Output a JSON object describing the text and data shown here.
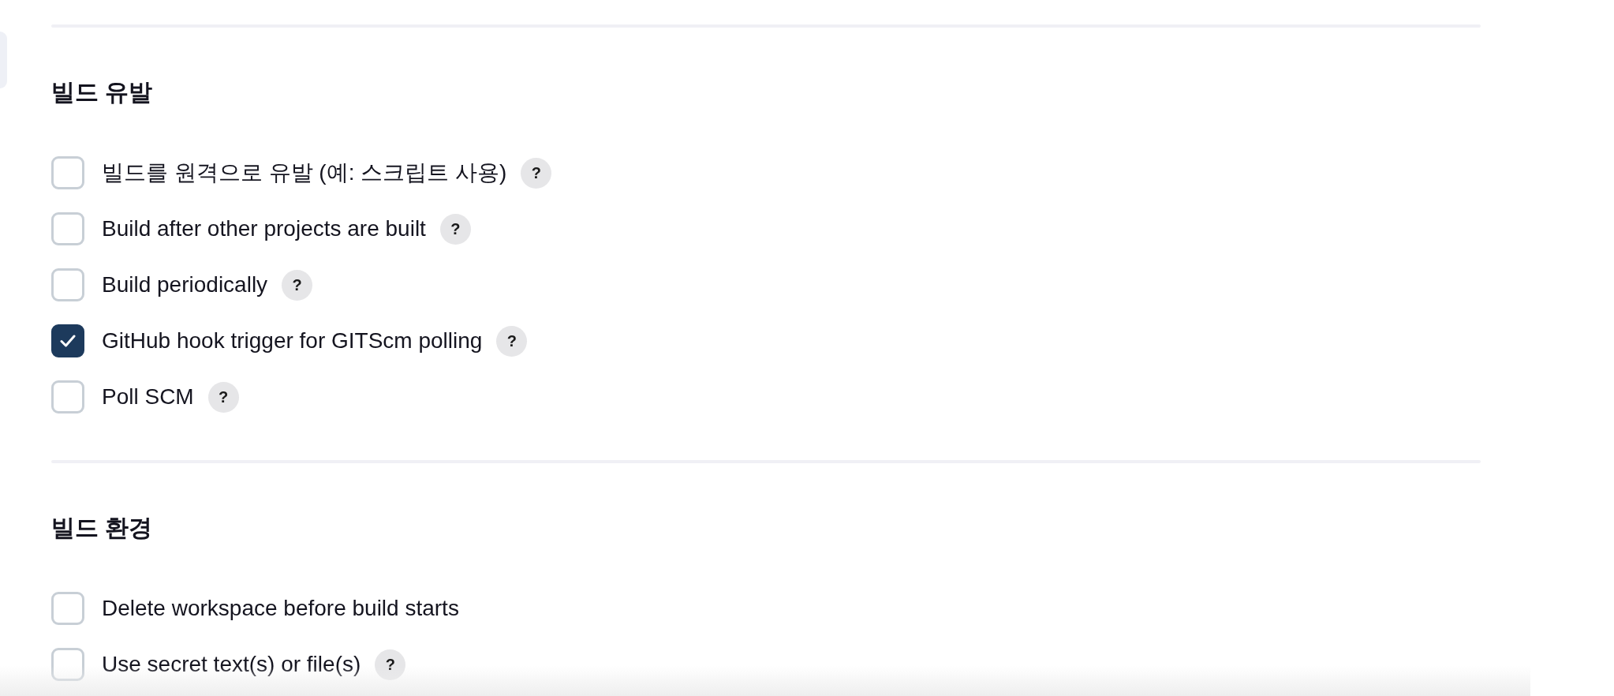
{
  "sections": [
    {
      "title": "빌드 유발",
      "options": [
        {
          "label": "빌드를 원격으로 유발 (예: 스크립트 사용)",
          "checked": false,
          "help": "?"
        },
        {
          "label": "Build after other projects are built",
          "checked": false,
          "help": "?"
        },
        {
          "label": "Build periodically",
          "checked": false,
          "help": "?"
        },
        {
          "label": "GitHub hook trigger for GITScm polling",
          "checked": true,
          "help": "?"
        },
        {
          "label": "Poll SCM",
          "checked": false,
          "help": "?"
        }
      ]
    },
    {
      "title": "빌드 환경",
      "options": [
        {
          "label": "Delete workspace before build starts",
          "checked": false
        },
        {
          "label": "Use secret text(s) or file(s)",
          "checked": false,
          "help": "?"
        }
      ]
    }
  ]
}
